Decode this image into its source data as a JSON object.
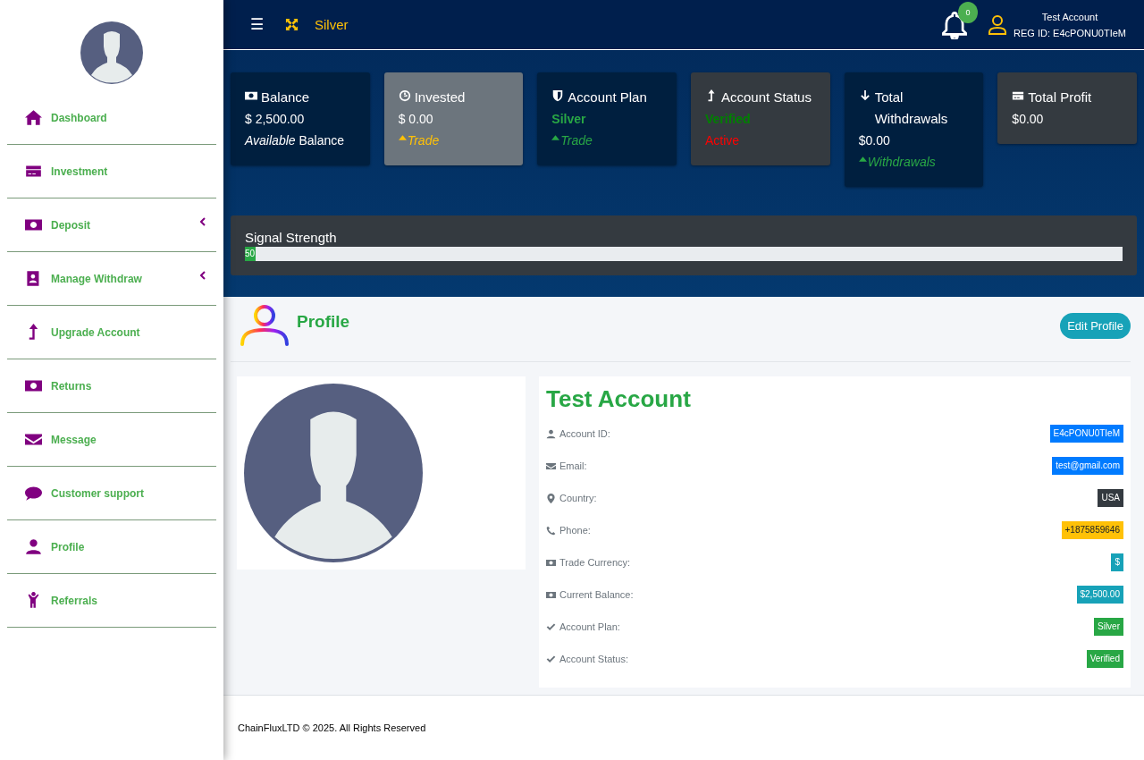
{
  "sidebar": {
    "items": [
      {
        "label": "Dashboard",
        "expandable": false
      },
      {
        "label": "Investment",
        "expandable": false
      },
      {
        "label": "Deposit",
        "expandable": true
      },
      {
        "label": "Manage Withdraw",
        "expandable": true
      },
      {
        "label": "Upgrade Account",
        "expandable": false
      },
      {
        "label": "Returns",
        "expandable": false
      },
      {
        "label": "Message",
        "expandable": false
      },
      {
        "label": "Customer support",
        "expandable": false
      },
      {
        "label": "Profile",
        "expandable": false
      },
      {
        "label": "Referrals",
        "expandable": false
      }
    ]
  },
  "topbar": {
    "menu": "☰",
    "plan": "Silver",
    "notifications": "0",
    "user_name": "Test Account",
    "reg_id": "REG ID: E4cPONU0TIeM"
  },
  "cards": [
    {
      "title": "Balance",
      "color": "#001f3f",
      "lines": [
        {
          "kind": "value",
          "text": "$ 2,500.00",
          "color": "#ffffff"
        },
        {
          "kind": "value",
          "text": "*Available* Balance",
          "color": "#ffffff"
        }
      ]
    },
    {
      "title": "Invested",
      "color": "#6c757d",
      "lines": [
        {
          "kind": "value",
          "text": "$ 0.00",
          "color": "#ffffff"
        },
        {
          "kind": "trend",
          "text": "Trade",
          "color": "#ffc107"
        }
      ]
    },
    {
      "title": "Account Plan",
      "color": "#001f3f",
      "lines": [
        {
          "kind": "strong",
          "text": "Silver",
          "color": "#28a745"
        },
        {
          "kind": "trend",
          "text": "Trade",
          "color": "#28a745"
        }
      ]
    },
    {
      "title": "Account Status",
      "color": "#343a40",
      "lines": [
        {
          "kind": "strong",
          "text": "Verified",
          "color": "#008000"
        },
        {
          "kind": "value",
          "text": "Active",
          "color": "#ff0000"
        }
      ]
    },
    {
      "title": "Total Withdrawals",
      "color": "#001f3f",
      "lines": [
        {
          "kind": "value",
          "text": "$0.00",
          "color": "#ffffff"
        },
        {
          "kind": "trend",
          "text": "Withdrawals",
          "color": "#28a745"
        }
      ]
    },
    {
      "title": "Total Profit",
      "color": "#343a40",
      "lines": [
        {
          "kind": "value",
          "text": "$0.00",
          "color": "#ffffff"
        }
      ]
    }
  ],
  "signal": {
    "title": "Signal Strength",
    "level": 0.012,
    "reading": "50"
  },
  "profile": {
    "heading": "Profile",
    "edit_button": "Edit Profile",
    "name": "Test Account",
    "rows": [
      {
        "label": "Account ID:",
        "value": "E4cPONU0TIeM",
        "color": "#007bff"
      },
      {
        "label": "Email:",
        "value": "test@gmail.com",
        "color": "#007bff"
      },
      {
        "label": "Country:",
        "value": "USA",
        "color": "#343a40"
      },
      {
        "label": "Phone:",
        "value": "+1875859646",
        "color": "#ffc107"
      },
      {
        "label": "Trade Currency:",
        "value": "$",
        "color": "#17a2b8"
      },
      {
        "label": "Current Balance:",
        "value": "$2,500.00",
        "color": "#17a2b8"
      },
      {
        "label": "Account Plan:",
        "value": "Silver",
        "color": "#28a745"
      },
      {
        "label": "Account Status:",
        "value": "Verified",
        "color": "#28a745"
      }
    ]
  },
  "footer": "ChainFluxLTD © 2025. All Rights Reserved"
}
